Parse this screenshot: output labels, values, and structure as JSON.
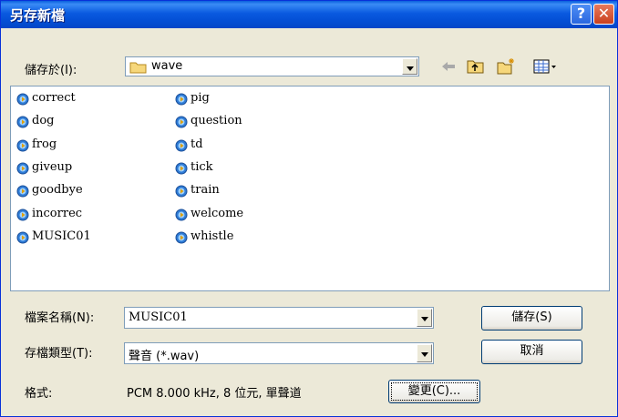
{
  "window": {
    "title": "另存新檔",
    "help_glyph": "?",
    "close_glyph": "✕"
  },
  "lookin": {
    "label": "儲存於(I):",
    "value": "wave"
  },
  "files": {
    "col1": [
      "correct",
      "dog",
      "frog",
      "giveup",
      "goodbye",
      "incorrec",
      "MUSIC01"
    ],
    "col2": [
      "pig",
      "question",
      "td",
      "tick",
      "train",
      "welcome",
      "whistle"
    ]
  },
  "filename": {
    "label": "檔案名稱(N):",
    "value": "MUSIC01"
  },
  "filetype": {
    "label": "存檔類型(T):",
    "value": "聲音 (*.wav)"
  },
  "format": {
    "label": "格式:",
    "value": "PCM 8.000 kHz, 8 位元, 單聲道"
  },
  "buttons": {
    "save": "儲存(S)",
    "cancel": "取消",
    "change": "變更(C)..."
  },
  "icons": {
    "back": "back-arrow-icon",
    "up": "up-folder-icon",
    "newfolder": "new-folder-icon",
    "view": "view-menu-icon"
  },
  "colors": {
    "titlebar": "#0A5AE0",
    "dialog_bg": "#ECE9D8",
    "close": "#C9401F"
  }
}
